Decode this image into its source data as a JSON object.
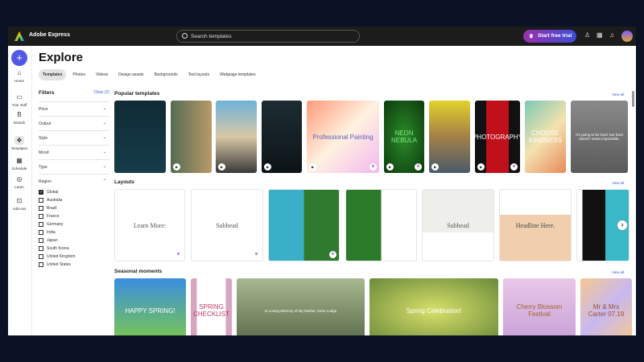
{
  "app": {
    "name": "Adobe Express",
    "search_placeholder": "Search templates",
    "trial": "Start free trial"
  },
  "rail": [
    {
      "label": "Home",
      "icon": "⌂"
    },
    {
      "label": "Your stuff",
      "icon": "▭"
    },
    {
      "label": "Brands",
      "icon": "B"
    },
    {
      "label": "Templates",
      "icon": "❖"
    },
    {
      "label": "Schedule",
      "icon": "▦"
    },
    {
      "label": "Learn",
      "icon": "◎"
    },
    {
      "label": "Add-ons",
      "icon": "⊡"
    }
  ],
  "page": {
    "title": "Explore"
  },
  "tabs": [
    "Templates",
    "Photos",
    "Videos",
    "Design assets",
    "Backgrounds",
    "Text layouts",
    "Webpage templates"
  ],
  "filters": {
    "title": "Filters",
    "clear": "Clear (2)",
    "groups": [
      "Price",
      "Output",
      "Style",
      "Mood",
      "Type"
    ],
    "region": "Region",
    "regions": [
      {
        "label": "Global",
        "checked": true
      },
      {
        "label": "Australia"
      },
      {
        "label": "Brazil"
      },
      {
        "label": "France"
      },
      {
        "label": "Germany"
      },
      {
        "label": "India"
      },
      {
        "label": "Japan"
      },
      {
        "label": "South Korea"
      },
      {
        "label": "United Kingdom"
      },
      {
        "label": "United States"
      }
    ]
  },
  "sections": {
    "popular": "Popular templates",
    "layouts": "Layouts",
    "seasonal": "Seasonal moments",
    "view_all": "View all"
  },
  "popular": [
    {
      "text": "",
      "bg": "linear-gradient(#0f2a36,#163d4a)"
    },
    {
      "text": "",
      "bg": "linear-gradient(90deg,#556b52,#b89a6a)"
    },
    {
      "text": "",
      "bg": "linear-gradient(#6fb2d9,#d8c7a5,#3a3a3a)"
    },
    {
      "text": "",
      "bg": "linear-gradient(#1d2c33,#0d1418)"
    },
    {
      "text": "Professional Painting",
      "bg": "linear-gradient(135deg,#ff9a7a,#fff2e0,#f4b8f0)",
      "color": "#5a5fc0"
    },
    {
      "text": "NEON NEBULA",
      "bg": "radial-gradient(#2b8a2b,#0c3a0c)",
      "color": "#7eea7e"
    },
    {
      "text": "",
      "bg": "linear-gradient(#e2d22a,#a38048,#4a5a6a)"
    },
    {
      "text": "PHOTOGRAPHY",
      "bg": "linear-gradient(90deg,#111 25%,#c0101a 25%,#c0101a 75%,#111 75%)",
      "color": "#fff"
    },
    {
      "text": "CHOOSE KINDNESS",
      "bg": "linear-gradient(135deg,#7cc9b4,#f4e2b0,#e88a5a)",
      "color": "#fff"
    },
    {
      "text": "It's going to be hard, but hard doesn't mean impossible.",
      "bg": "linear-gradient(#8a8a8a,#5a5a5a)",
      "color": "#fff"
    }
  ],
  "layouts": [
    {
      "text": "Learn More:",
      "bg": "#fff",
      "color": "#555"
    },
    {
      "text": "Subhead",
      "bg": "#fff",
      "color": "#555"
    },
    {
      "text": "",
      "bg": "linear-gradient(90deg,#3ab0c8 50%,#2f7a2f 50%)"
    },
    {
      "text": "",
      "bg": "linear-gradient(90deg,#2a7a2a 50%,#fff 50%)"
    },
    {
      "text": "Subhead",
      "bg": "linear-gradient(#eeeeea 60%,#fff 60%)",
      "color": "#555"
    },
    {
      "text": "Headline Here.",
      "bg": "linear-gradient(#fff 35%,#f1cfae 35%)",
      "color": "#444"
    },
    {
      "text": "",
      "bg": "linear-gradient(90deg,#fff 10%,#111 10%,#111 55%,#3ab8c8 55%)"
    }
  ],
  "seasonal": [
    {
      "text": "HAPPY SPRING!",
      "bg": "linear-gradient(#3a8ee0,#7cc94a)",
      "color": "#fff"
    },
    {
      "text": "SPRING CHECKLIST",
      "bg": "linear-gradient(90deg,#d9a4c0 15%,#fff 15%,#fff 85%,#d9a4c0 85%)",
      "color": "#c03a6a"
    },
    {
      "text": "In Loving Memory of My Mother, Irene Lodge",
      "bg": "linear-gradient(#a8b890,#5a6a4a)",
      "color": "#fff"
    },
    {
      "text": "Spring Celebration!",
      "bg": "radial-gradient(#d8e06a,#6a8a3a)",
      "color": "#fff"
    },
    {
      "text": "Cherry Blossom Festival",
      "bg": "linear-gradient(#e8c8e8,#c8a0d8)",
      "color": "#a0642a"
    },
    {
      "text": "Mr & Mrs Carter 07.19",
      "bg": "linear-gradient(135deg,#f6c890,#c8b8f0,#f6c890)",
      "color": "#a05030"
    }
  ]
}
